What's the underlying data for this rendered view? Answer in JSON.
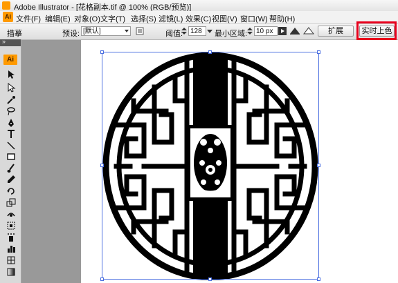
{
  "window": {
    "title": "Adobe Illustrator - [花格副本.tif @ 100% (RGB/预览)]"
  },
  "app": {
    "logo": "Ai"
  },
  "menu": [
    "文件(F)",
    "编辑(E)",
    "对象(O)",
    "文字(T)",
    "选择(S)",
    "滤镜(L)",
    "效果(C)",
    "视图(V)",
    "窗口(W)",
    "帮助(H)"
  ],
  "control": {
    "mode_label": "描摹",
    "preset_label": "预设:",
    "preset_value": "[默认]",
    "threshold_label": "阈值:",
    "threshold_value": "128",
    "min_area_label": "最小区域:",
    "min_area_value": "10 px",
    "expand_button": "扩展",
    "live_paint_button": "实时上色"
  },
  "toolbar": {
    "collapse": "»",
    "badge": "Ai"
  },
  "icons": [
    "selection-tool-icon",
    "direct-selection-tool-icon",
    "magic-wand-tool-icon",
    "lasso-tool-icon",
    "pen-tool-icon",
    "type-tool-icon",
    "line-tool-icon",
    "rectangle-tool-icon",
    "paintbrush-tool-icon",
    "pencil-tool-icon",
    "rotate-tool-icon",
    "scale-tool-icon",
    "warp-tool-icon",
    "free-transform-tool-icon",
    "symbol-sprayer-tool-icon",
    "column-graph-tool-icon",
    "mesh-tool-icon",
    "gradient-tool-icon"
  ],
  "colors": {
    "highlight": "#e8001c",
    "selection": "#4a6ee0",
    "app_orange": "#ff9a00",
    "canvas": "#999999"
  }
}
